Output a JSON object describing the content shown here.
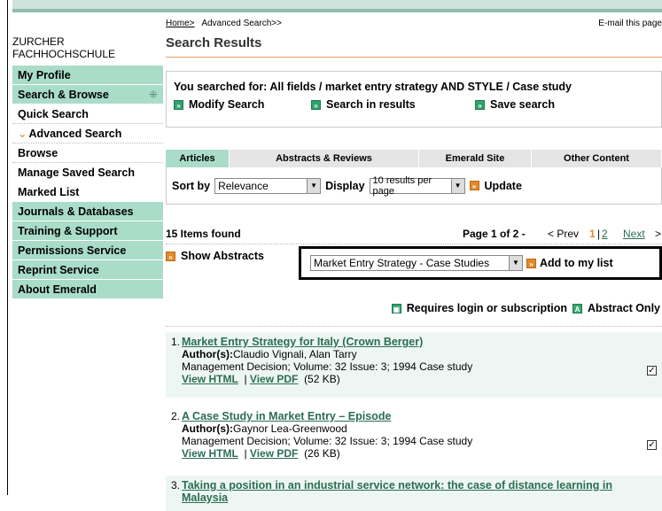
{
  "org": {
    "line1": "ZURCHER",
    "line2": "FACHHOCHSCHULE"
  },
  "sidebar": {
    "items": [
      {
        "label": "My Profile"
      },
      {
        "label": "Search & Browse",
        "symbol": "⁜"
      },
      {
        "label": "Quick Search"
      },
      {
        "label": "Advanced Search"
      },
      {
        "label": "Browse"
      },
      {
        "label": "Manage Saved Search"
      },
      {
        "label": "Marked List"
      },
      {
        "label": "Journals & Databases"
      },
      {
        "label": "Training & Support"
      },
      {
        "label": "Permissions Service"
      },
      {
        "label": "Reprint Service"
      },
      {
        "label": "About Emerald"
      }
    ]
  },
  "breadcrumb": {
    "home": "Home>",
    "current": "Advanced Search>>",
    "email": "E-mail this page"
  },
  "page_title": "Search Results",
  "search": {
    "summary": "You searched for: All fields / market entry strategy AND STYLE / Case study",
    "modify": "Modify Search",
    "within": "Search in results",
    "save": "Save search"
  },
  "tabs": [
    {
      "label": "Articles"
    },
    {
      "label": "Abstracts & Reviews"
    },
    {
      "label": "Emerald Site"
    },
    {
      "label": "Other Content"
    }
  ],
  "sort": {
    "label": "Sort by",
    "value": "Relevance",
    "display_label": "Display",
    "display_value": "10 results per page",
    "update": "Update"
  },
  "paging": {
    "found": "15 Items found",
    "page": "Page 1 of 2 -",
    "prev": "< Prev",
    "current": "1",
    "sep": "|",
    "p2": "2",
    "next": "Next",
    "gt": ">"
  },
  "abstracts": {
    "show": "Show Abstracts",
    "list_value": "Market Entry Strategy - Case Studies",
    "add": "Add to my list"
  },
  "legend": {
    "login": "Requires login or subscription",
    "abstract": "Abstract Only"
  },
  "results": [
    {
      "num": "1.",
      "title": "Market Entry Strategy for Italy (Crown Berger)",
      "authors_label": "Author(s):",
      "authors": "Claudio Vignali, Alan Tarry",
      "source": "Management Decision; Volume: 32   Issue: 3; 1994 Case study",
      "html": "View HTML",
      "pdf": "View PDF",
      "size": "(52 KB)"
    },
    {
      "num": "2.",
      "title": "A Case Study in Market Entry – Episode",
      "authors_label": "Author(s):",
      "authors": "Gaynor Lea-Greenwood",
      "source": "Management Decision; Volume: 32   Issue: 3; 1994 Case study",
      "html": "View HTML",
      "pdf": "View PDF",
      "size": "(26 KB)"
    },
    {
      "num": "3.",
      "title": "Taking a position in an industrial service network: the case of distance learning in Malaysia"
    }
  ]
}
